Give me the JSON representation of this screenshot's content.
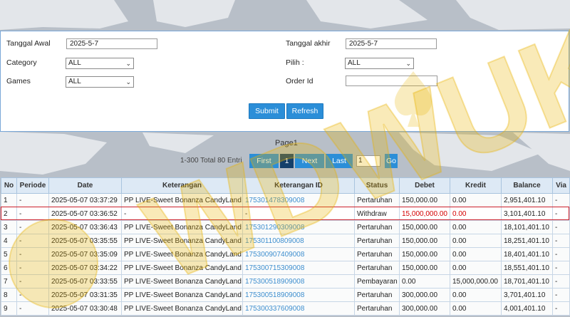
{
  "filters": {
    "tanggal_awal_label": "Tanggal Awal",
    "tanggal_awal_value": "2025-5-7",
    "tanggal_akhir_label": "Tanggal akhir",
    "tanggal_akhir_value": "2025-5-7",
    "category_label": "Category",
    "category_value": "ALL",
    "pilih_label": "Pilih  :",
    "pilih_value": "ALL",
    "games_label": "Games",
    "games_value": "ALL",
    "order_id_label": "Order Id",
    "order_id_value": "",
    "submit_label": "Submit",
    "refresh_label": "Refresh"
  },
  "pagination": {
    "title": "Page1",
    "info": "1-300 Total 80 Entri",
    "first_label": "First",
    "current_page": "1",
    "next_label": "Next",
    "last_label": "Last",
    "page_input_value": "1",
    "go_label": "Go"
  },
  "table": {
    "headers": [
      "No",
      "Periode",
      "Date",
      "Keterangan",
      "Keterangan ID",
      "Status",
      "Debet",
      "Kredit",
      "Balance",
      "Via"
    ],
    "rows": [
      {
        "no": "1",
        "periode": "-",
        "date": "2025-05-07 03:37:29",
        "keterangan": "PP LIVE-Sweet Bonanza CandyLand",
        "keterangan_id": "175301478309008",
        "status": "Pertaruhan",
        "debet": "150,000.00",
        "kredit": "0.00",
        "balance": "2,951,401.10",
        "via": "-"
      },
      {
        "no": "2",
        "periode": "-",
        "date": "2025-05-07 03:36:52",
        "keterangan": "-",
        "keterangan_id": "-",
        "status": "Withdraw",
        "debet": "15,000,000.00",
        "kredit": "0.00",
        "balance": "3,101,401.10",
        "via": "-"
      },
      {
        "no": "3",
        "periode": "-",
        "date": "2025-05-07 03:36:43",
        "keterangan": "PP LIVE-Sweet Bonanza CandyLand",
        "keterangan_id": "175301290309008",
        "status": "Pertaruhan",
        "debet": "150,000.00",
        "kredit": "0.00",
        "balance": "18,101,401.10",
        "via": "-"
      },
      {
        "no": "4",
        "periode": "-",
        "date": "2025-05-07 03:35:55",
        "keterangan": "PP LIVE-Sweet Bonanza CandyLand",
        "keterangan_id": "175301100809008",
        "status": "Pertaruhan",
        "debet": "150,000.00",
        "kredit": "0.00",
        "balance": "18,251,401.10",
        "via": "-"
      },
      {
        "no": "5",
        "periode": "-",
        "date": "2025-05-07 03:35:09",
        "keterangan": "PP LIVE-Sweet Bonanza CandyLand",
        "keterangan_id": "175300907409008",
        "status": "Pertaruhan",
        "debet": "150,000.00",
        "kredit": "0.00",
        "balance": "18,401,401.10",
        "via": "-"
      },
      {
        "no": "6",
        "periode": "-",
        "date": "2025-05-07 03:34:22",
        "keterangan": "PP LIVE-Sweet Bonanza CandyLand",
        "keterangan_id": "175300715309008",
        "status": "Pertaruhan",
        "debet": "150,000.00",
        "kredit": "0.00",
        "balance": "18,551,401.10",
        "via": "-"
      },
      {
        "no": "7",
        "periode": "-",
        "date": "2025-05-07 03:33:55",
        "keterangan": "PP LIVE-Sweet Bonanza CandyLand",
        "keterangan_id": "175300518909008",
        "status": "Pembayaran",
        "debet": "0.00",
        "kredit": "15,000,000.00",
        "balance": "18,701,401.10",
        "via": "-"
      },
      {
        "no": "8",
        "periode": "-",
        "date": "2025-05-07 03:31:35",
        "keterangan": "PP LIVE-Sweet Bonanza CandyLand",
        "keterangan_id": "175300518909008",
        "status": "Pertaruhan",
        "debet": "300,000.00",
        "kredit": "0.00",
        "balance": "3,701,401.10",
        "via": "-"
      },
      {
        "no": "9",
        "periode": "-",
        "date": "2025-05-07 03:30:48",
        "keterangan": "PP LIVE-Sweet Bonanza CandyLand",
        "keterangan_id": "175300337609008",
        "status": "Pertaruhan",
        "debet": "300,000.00",
        "kredit": "0.00",
        "balance": "4,001,401.10",
        "via": "-"
      }
    ]
  },
  "watermark": {
    "text": "WDWUK",
    "icon": "spade-icon"
  },
  "colors": {
    "accent": "#2b8ed8",
    "active_page": "#15406b",
    "highlight": "#cc1f2b",
    "link": "#3f8fcf",
    "watermark": "#e8b300"
  }
}
